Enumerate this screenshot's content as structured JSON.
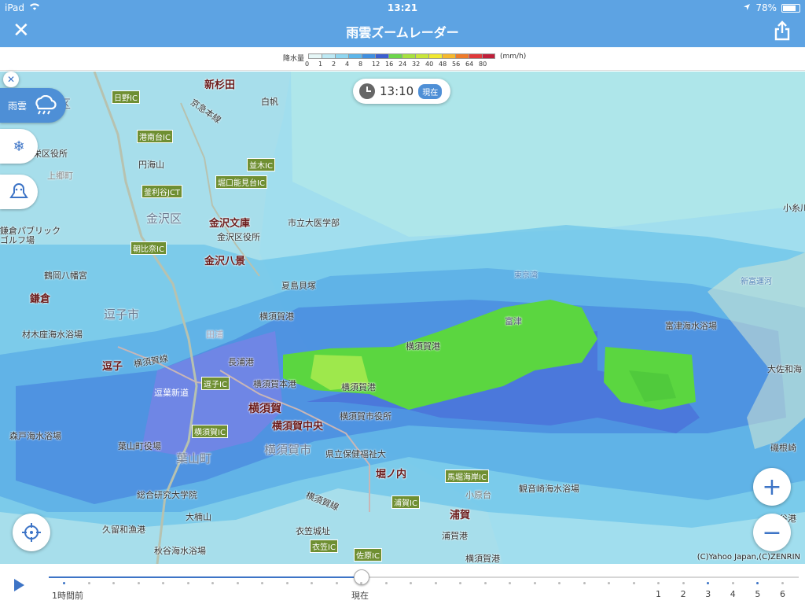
{
  "status": {
    "device": "iPad",
    "time": "13:21",
    "battery": "78%"
  },
  "nav": {
    "title": "雨雲ズームレーダー"
  },
  "legend": {
    "label": "降水量",
    "unit": "(mm/h)",
    "ticks": [
      "0",
      "1",
      "2",
      "4",
      "8",
      "12",
      "16",
      "24",
      "32",
      "40",
      "48",
      "56",
      "64",
      "80"
    ],
    "colors": [
      "#e6f7f7",
      "#bde9f4",
      "#8fd6f0",
      "#5cb6ea",
      "#3f8fe0",
      "#3c5fd0",
      "#6cd64a",
      "#a7e23f",
      "#c8e63a",
      "#f1e830",
      "#f6b82c",
      "#ef7b2a",
      "#e0383a",
      "#c01f3a"
    ]
  },
  "timepill": {
    "time": "13:10",
    "now_label": "現在"
  },
  "layers": {
    "rain_label": "雨雲"
  },
  "map_labels": {
    "shinsugita": "新杉田",
    "hakuho": "白帆",
    "minamiku": "南区",
    "hino_ic": "日野IC",
    "keikyu_line": "京急本線",
    "konandai_ic": "港南台IC",
    "ward_office": "栄区役所",
    "kamigomachi": "上郷町",
    "enkaiyama": "円海山",
    "namiki_ic": "並木IC",
    "horiguchi_ic": "堀口能見台IC",
    "kamariya_jct": "釜利谷JCT",
    "kanazawa_ku": "金沢区",
    "kanazawa_bunko": "金沢文庫",
    "yokohama_city_univ": "市立大医学部",
    "kanazawa_ward": "金沢区役所",
    "kamakura_golf": "鎌倉パブリック",
    "golf_jo": "ゴルフ場",
    "asahina_ic": "朝比奈IC",
    "kanazawa_hakkei": "金沢八景",
    "tsurugaoka": "鶴岡八幡宮",
    "natsushima": "夏島貝塚",
    "kamakura": "鎌倉",
    "zushi_city": "逗子市",
    "yokosuka_port_1": "横須賀港",
    "zaimokuza": "材木座海水浴場",
    "taura": "田浦",
    "nagaura": "長浦港",
    "zushi": "逗子",
    "yokosuka_line": "横須賀線",
    "zushi_ic": "逗子IC",
    "yokosuka_honko": "横須賀本港",
    "yokosuka_port_2": "横須賀港",
    "yokosuka_port_3": "横須賀港",
    "zushi_shindo": "逗葉新道",
    "yokosuka": "横須賀",
    "yokosuka_city_office": "横須賀市役所",
    "morito": "森戸海水浴場",
    "yokosuka_ic": "横須賀IC",
    "yokosuka_chuo": "横須賀中央",
    "hayama_office": "葉山町役場",
    "yokosuka_city": "横須賀市",
    "kenritsu_hoken": "県立保健福祉大",
    "hayama_machi": "葉山町",
    "horinouchi": "堀ノ内",
    "mabori_ic": "馬堀海岸IC",
    "soken_univ": "総合研究大学院",
    "kannonzaki": "観音崎海水浴場",
    "kobaradai": "小原台",
    "yokosuka_rikusen": "横須賀線",
    "uraga_ic": "浦賀IC",
    "ogusu": "大楠山",
    "uraga": "浦賀",
    "kurowa": "久留和漁港",
    "kinugasa": "衣笠城址",
    "akiya": "秋谷海水浴場",
    "kinugasa_ic": "衣笠IC",
    "sahara_ic": "佐原IC",
    "uraga_port": "浦賀港",
    "yokosuka_port_4": "横須賀港",
    "tokyo_bay": "東京湾",
    "futtsu": "富津",
    "shin_fujimi": "新富運河",
    "futtsu_beach": "富津海水浴場",
    "oitomo": "大佐和海",
    "isone": "磯根崎",
    "koito": "小糸川",
    "kana_pt": "金谷港"
  },
  "copyright": "(C)Yahoo Japan,(C)ZENRIN",
  "timeline": {
    "progress": 0.417,
    "left_label": "1時間前",
    "current_label": "現在",
    "hour_labels": [
      "1",
      "2",
      "3",
      "4",
      "5",
      "6"
    ]
  }
}
